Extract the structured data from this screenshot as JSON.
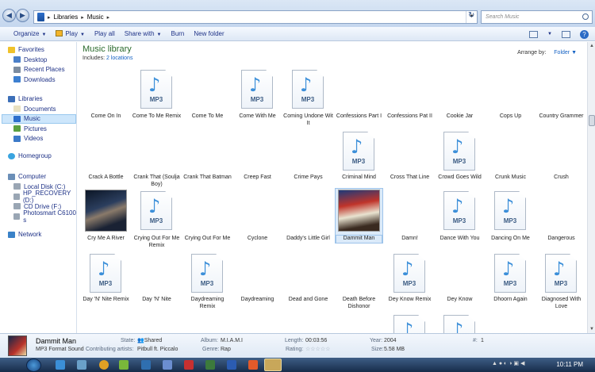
{
  "address": {
    "crumbs": [
      "Libraries",
      "Music"
    ],
    "search_placeholder": "Search Music"
  },
  "toolbar": {
    "organize": "Organize",
    "play": "Play",
    "play_all": "Play all",
    "share_with": "Share with",
    "burn": "Burn",
    "new_folder": "New folder"
  },
  "nav": {
    "favorites": "Favorites",
    "favorites_items": [
      "Desktop",
      "Recent Places",
      "Downloads"
    ],
    "libraries": "Libraries",
    "libraries_items": [
      "Documents",
      "Music",
      "Pictures",
      "Videos"
    ],
    "homegroup": "Homegroup",
    "computer": "Computer",
    "computer_items": [
      "Local Disk (C:)",
      "HP_RECOVERY (D:)",
      "CD Drive (F:)",
      "Photosmart C6100 s"
    ],
    "network": "Network"
  },
  "library": {
    "title": "Music library",
    "includes_label": "Includes:",
    "includes_link": "2 locations",
    "arrange_label": "Arrange by:",
    "arrange_value": "Folder"
  },
  "files": [
    {
      "name": "Come On In",
      "icon": ""
    },
    {
      "name": "Come To Me Remix",
      "icon": "mp3"
    },
    {
      "name": "Come To Me",
      "icon": ""
    },
    {
      "name": "Come With Me",
      "icon": "mp3"
    },
    {
      "name": "Coming Undone Wit It",
      "icon": "mp3"
    },
    {
      "name": "Confessions Part I",
      "icon": ""
    },
    {
      "name": "Confessions Pat II",
      "icon": ""
    },
    {
      "name": "Cookie Jar",
      "icon": ""
    },
    {
      "name": "Cops Up",
      "icon": ""
    },
    {
      "name": "Country Grammer",
      "icon": ""
    },
    {
      "name": "Crack A Bottle",
      "icon": ""
    },
    {
      "name": "Crank That (Soulja Boy)",
      "icon": ""
    },
    {
      "name": "Crank That Batman",
      "icon": ""
    },
    {
      "name": "Creep Fast",
      "icon": ""
    },
    {
      "name": "Crime Pays",
      "icon": ""
    },
    {
      "name": "Criminal Mind",
      "icon": "mp3"
    },
    {
      "name": "Cross That Line",
      "icon": ""
    },
    {
      "name": "Crowd Goes Wild",
      "icon": "mp3"
    },
    {
      "name": "Crunk Music",
      "icon": ""
    },
    {
      "name": "Crush",
      "icon": ""
    },
    {
      "name": "Cry Me A River",
      "icon": "album-dark"
    },
    {
      "name": "Crying Out For Me Remix",
      "icon": "mp3"
    },
    {
      "name": "Crying Out For Me",
      "icon": ""
    },
    {
      "name": "Cyclone",
      "icon": ""
    },
    {
      "name": "Daddy's Little Girl",
      "icon": ""
    },
    {
      "name": "Dammit Man",
      "icon": "album-pitbull"
    },
    {
      "name": "Damn!",
      "icon": ""
    },
    {
      "name": "Dance With You",
      "icon": "mp3"
    },
    {
      "name": "Dancing On Me",
      "icon": "mp3"
    },
    {
      "name": "Dangerous",
      "icon": ""
    },
    {
      "name": "Day 'N' Nite Remix",
      "icon": "mp3"
    },
    {
      "name": "Day 'N' Nite",
      "icon": ""
    },
    {
      "name": "Daydreaming Remix",
      "icon": "mp3"
    },
    {
      "name": "Daydreaming",
      "icon": ""
    },
    {
      "name": "Dead and Gone",
      "icon": ""
    },
    {
      "name": "Death Before Dishonor",
      "icon": ""
    },
    {
      "name": "Dey Know Remix",
      "icon": "mp3"
    },
    {
      "name": "Dey Know",
      "icon": ""
    },
    {
      "name": "Dhoorn Again",
      "icon": "mp3"
    },
    {
      "name": "Diagnosed With Love",
      "icon": "mp3"
    }
  ],
  "partial_row": [
    {
      "icon": "mp3"
    },
    {
      "icon": "mp3"
    }
  ],
  "mp3_label": "MP3",
  "details": {
    "title": "Dammit Man",
    "type": "MP3 Format Sound",
    "state_label": "State:",
    "state": "Shared",
    "contrib_label": "Contributing artists:",
    "contrib": "Pitbull ft. Piccalo",
    "album_label": "Album:",
    "album": "M.I.A.M.I",
    "genre_label": "Genre:",
    "genre": "Rap",
    "length_label": "Length:",
    "length": "00:03:56",
    "rating_label": "Rating:",
    "rating_stars": "☆☆☆☆☆",
    "year_label": "Year:",
    "year": "2004",
    "size_label": "Size:",
    "size": "5.58 MB",
    "track_label": "#:",
    "track": "1"
  },
  "taskbar": {
    "clock": "10:11 PM"
  }
}
